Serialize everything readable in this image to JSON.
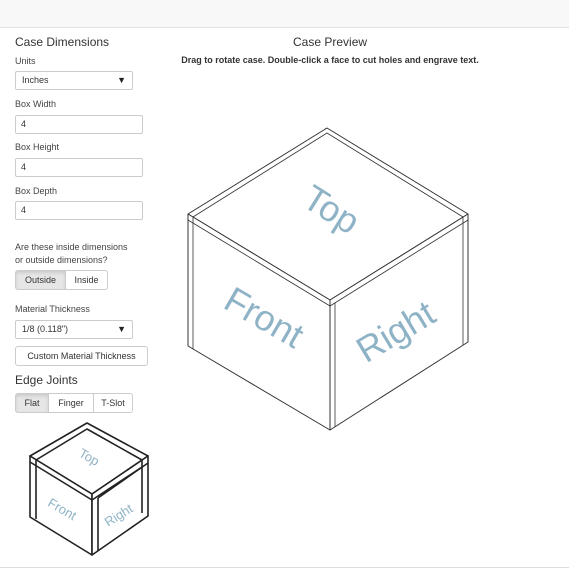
{
  "left_panel": {
    "case_dimensions_heading": "Case Dimensions",
    "units_label": "Units",
    "units_value": "Inches",
    "box_width_label": "Box Width",
    "box_width_value": "4",
    "box_height_label": "Box Height",
    "box_height_value": "4",
    "box_depth_label": "Box Depth",
    "box_depth_value": "4",
    "dimensions_question_line1": "Are these inside dimensions",
    "dimensions_question_line2": "or outside dimensions?",
    "outside_label": "Outside",
    "inside_label": "Inside",
    "material_thickness_label": "Material Thickness",
    "material_thickness_value": "1/8 (0.118\")",
    "custom_thickness_label": "Custom Material Thickness",
    "edge_joints_heading": "Edge Joints",
    "joint_flat_label": "Flat",
    "joint_finger_label": "Finger",
    "joint_tslot_label": "T-Slot"
  },
  "preview": {
    "heading": "Case Preview",
    "instructions": "Drag to rotate case. Double-click a face to cut holes and engrave text.",
    "face_top": "Top",
    "face_front": "Front",
    "face_right": "Right"
  },
  "thumbnail": {
    "face_top": "Top",
    "face_front": "Front",
    "face_right": "Right"
  },
  "colors": {
    "face_text": "#8fb3c6",
    "edge": "#333333"
  }
}
